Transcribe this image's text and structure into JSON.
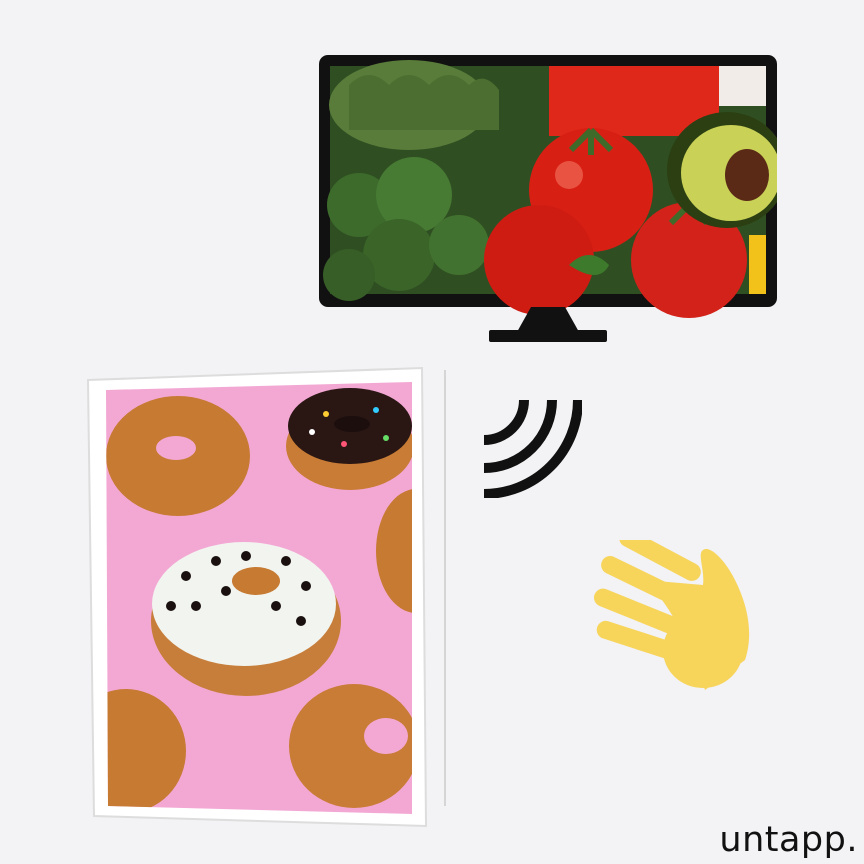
{
  "brand": {
    "wordmark": "untapp."
  },
  "screen": {
    "device": "tv-monitor-icon",
    "content": "vegetables-photo"
  },
  "tablet": {
    "device": "tablet-frame",
    "content": "donuts-photo"
  },
  "gesture": {
    "signal_icon": "wireless-signal-icon",
    "hand_icon": "waving-hand-icon"
  },
  "colors": {
    "background": "#f3f2f4",
    "device_black": "#111111",
    "donut_pink": "#f3a8d4",
    "hand_yellow": "#f7d45a",
    "tomato_red": "#d81f14",
    "broccoli_green": "#3d6b2c"
  }
}
